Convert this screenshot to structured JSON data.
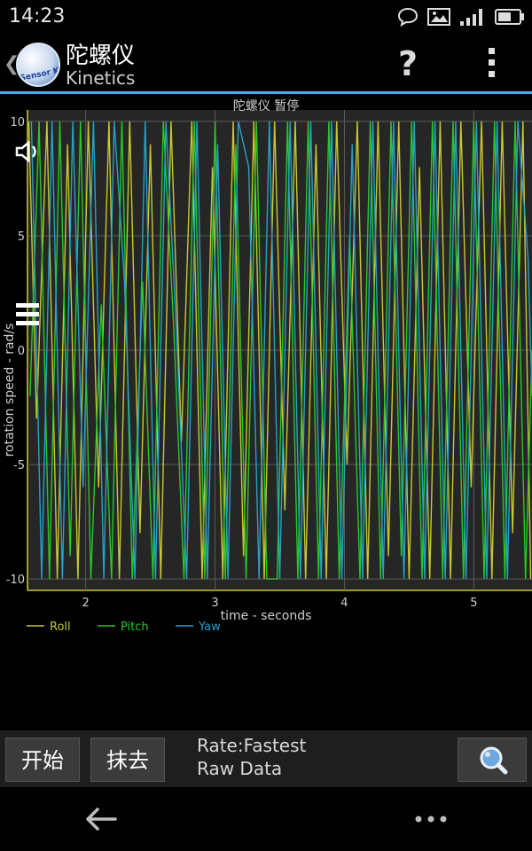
{
  "status_bar": {
    "time": "14:23"
  },
  "action_bar": {
    "title": "陀螺仪",
    "subtitle": "Kinetics",
    "help_label": "?",
    "logo_text": "Sensor Kinetics"
  },
  "chart": {
    "caption": "陀螺仪 暂停"
  },
  "toolbar": {
    "start_label": "开始",
    "clear_label": "抹去",
    "rate_text": "Rate:Fastest",
    "mode_text": "Raw Data"
  },
  "colors": {
    "accent": "#33b5e5",
    "roll": "#c8c832",
    "pitch": "#28c828",
    "yaw": "#28a0c8"
  },
  "chart_data": {
    "type": "line",
    "title": "陀螺仪 暂停",
    "xlabel": "time - seconds",
    "ylabel": "rotation speed - rad/s",
    "x_ticks": [
      2,
      3,
      4,
      5
    ],
    "y_ticks": [
      10,
      5,
      0,
      -5,
      -10
    ],
    "xlim": [
      1.55,
      5.45
    ],
    "ylim": [
      -10.5,
      10.5
    ],
    "grid": true,
    "legend_position": "bottom-left",
    "series": [
      {
        "name": "Roll",
        "color": "#c8c832",
        "x": [
          1.56,
          1.62,
          1.7,
          1.78,
          1.86,
          1.94,
          2.02,
          2.1,
          2.18,
          2.26,
          2.34,
          2.42,
          2.5,
          2.58,
          2.66,
          2.74,
          2.82,
          2.9,
          2.98,
          3.06,
          3.14,
          3.22,
          3.3,
          3.38,
          3.46,
          3.54,
          3.62,
          3.7,
          3.78,
          3.86,
          3.94,
          4.02,
          4.1,
          4.18,
          4.26,
          4.34,
          4.42,
          4.5,
          4.58,
          4.66,
          4.74,
          4.82,
          4.9,
          4.98,
          5.06,
          5.14,
          5.22,
          5.3,
          5.38,
          5.44
        ],
        "y": [
          10,
          -3,
          10,
          -10,
          9,
          -10,
          10,
          -6,
          10,
          -10,
          10,
          -8,
          9,
          -10,
          10,
          -4,
          10,
          -10,
          8,
          -10,
          10,
          -9,
          10,
          -10,
          10,
          -7,
          10,
          -10,
          9,
          -10,
          10,
          -5,
          10,
          -10,
          10,
          -9,
          10,
          -10,
          8,
          -10,
          10,
          -10,
          10,
          -6,
          10,
          -10,
          10,
          -8,
          10,
          -10
        ]
      },
      {
        "name": "Pitch",
        "color": "#28c828",
        "x": [
          1.57,
          1.64,
          1.72,
          1.8,
          1.88,
          1.96,
          2.04,
          2.12,
          2.2,
          2.28,
          2.36,
          2.44,
          2.52,
          2.6,
          2.68,
          2.76,
          2.84,
          2.92,
          3.0,
          3.08,
          3.16,
          3.24,
          3.32,
          3.4,
          3.48,
          3.56,
          3.64,
          3.72,
          3.8,
          3.88,
          3.96,
          4.04,
          4.12,
          4.2,
          4.28,
          4.36,
          4.44,
          4.52,
          4.6,
          4.68,
          4.76,
          4.84,
          4.92,
          5.0,
          5.08,
          5.16,
          5.24,
          5.32,
          5.4,
          5.45
        ],
        "y": [
          -2,
          10,
          -10,
          10,
          -9,
          10,
          -10,
          2,
          -10,
          10,
          -10,
          3,
          -10,
          10,
          1,
          -10,
          10,
          -10,
          10,
          -10,
          9,
          -10,
          10,
          -10,
          -10,
          10,
          -10,
          10,
          -10,
          10,
          -10,
          5,
          -10,
          10,
          -10,
          10,
          -9,
          10,
          -10,
          10,
          -10,
          10,
          -10,
          10,
          -10,
          10,
          -10,
          10,
          -10,
          0
        ]
      },
      {
        "name": "Yaw",
        "color": "#28a0c8",
        "x": [
          1.58,
          1.66,
          1.74,
          1.82,
          1.9,
          1.98,
          2.06,
          2.14,
          2.22,
          2.3,
          2.38,
          2.46,
          2.54,
          2.62,
          2.7,
          2.78,
          2.86,
          2.94,
          3.02,
          3.1,
          3.18,
          3.26,
          3.34,
          3.42,
          3.5,
          3.58,
          3.66,
          3.74,
          3.82,
          3.9,
          3.98,
          4.06,
          4.14,
          4.22,
          4.3,
          4.38,
          4.46,
          4.54,
          4.62,
          4.7,
          4.78,
          4.86,
          4.94,
          5.02,
          5.1,
          5.18,
          5.26,
          5.34,
          5.42,
          5.45
        ],
        "y": [
          10,
          -10,
          10,
          -10,
          10,
          -6,
          10,
          -10,
          10,
          3,
          -10,
          10,
          -10,
          10,
          1,
          -10,
          10,
          -10,
          9,
          -10,
          10,
          8,
          -10,
          10,
          -10,
          10,
          -10,
          10,
          -10,
          10,
          -10,
          9,
          -10,
          10,
          -10,
          10,
          -10,
          10,
          -10,
          10,
          -10,
          10,
          -10,
          10,
          -10,
          10,
          -10,
          10,
          4,
          -2
        ]
      }
    ]
  }
}
